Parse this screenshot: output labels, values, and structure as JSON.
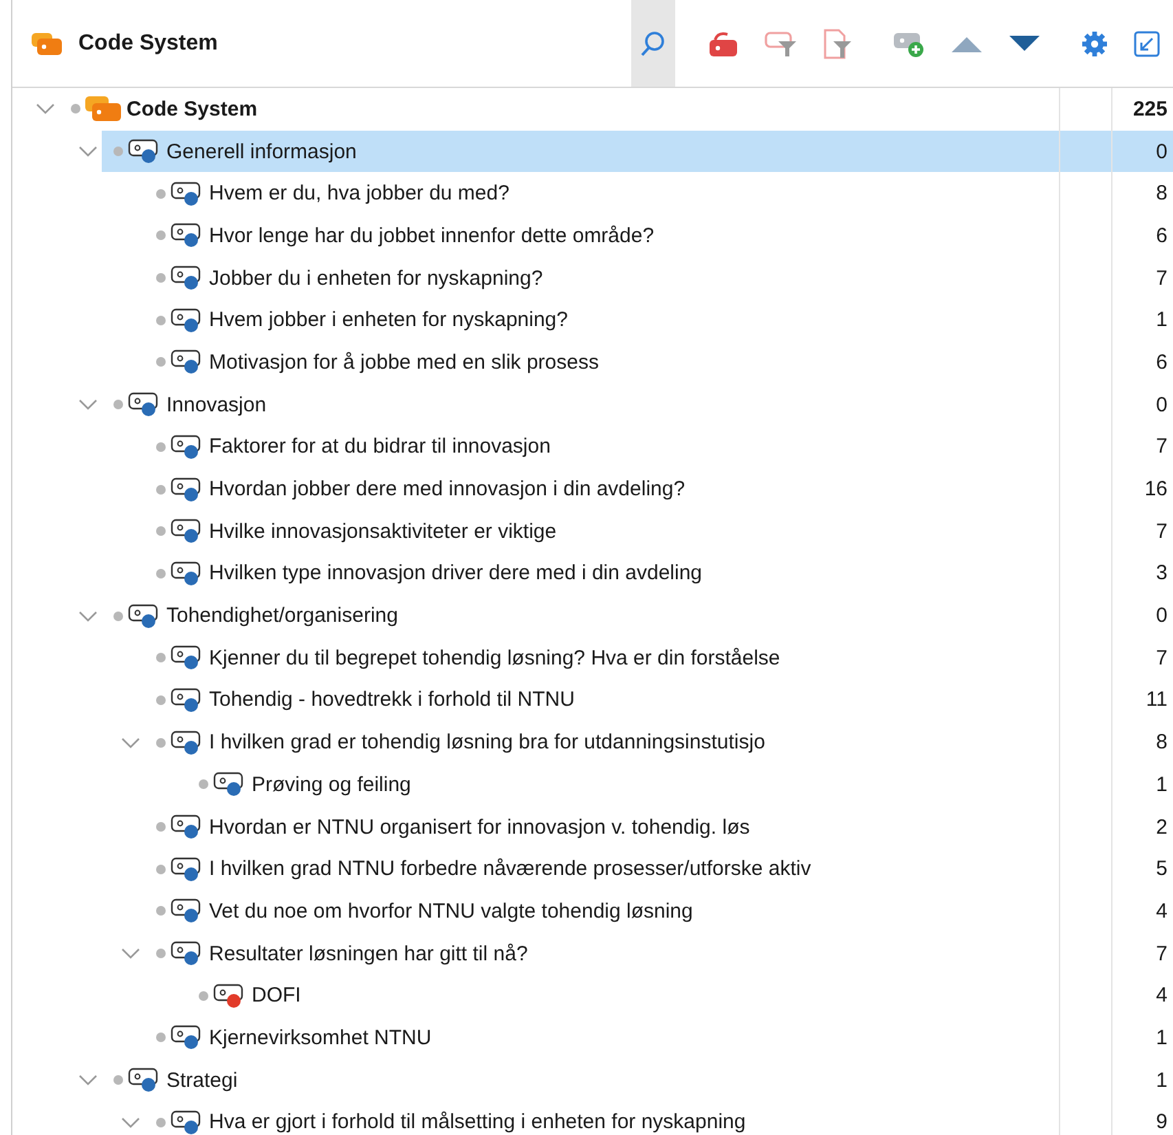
{
  "header": {
    "title": "Code System"
  },
  "tree": {
    "label": "Code System",
    "count": "225",
    "expanded": true,
    "selected": false,
    "children": [
      {
        "label": "Generell informasjon",
        "count": "0",
        "color": "#2a6cb5",
        "expanded": true,
        "selected": true,
        "children": [
          {
            "label": "Hvem er du, hva jobber du med?",
            "count": "8",
            "color": "#2a6cb5",
            "selected": false
          },
          {
            "label": "Hvor lenge har du jobbet innenfor dette område?",
            "count": "6",
            "color": "#2a6cb5",
            "selected": false
          },
          {
            "label": "Jobber du i enheten for nyskapning?",
            "count": "7",
            "color": "#2a6cb5",
            "selected": false
          },
          {
            "label": "Hvem jobber i enheten for nyskapning?",
            "count": "1",
            "color": "#2a6cb5",
            "selected": false
          },
          {
            "label": "Motivasjon for å jobbe med en slik prosess",
            "count": "6",
            "color": "#2a6cb5",
            "selected": false
          }
        ]
      },
      {
        "label": "Innovasjon",
        "count": "0",
        "color": "#2a6cb5",
        "expanded": true,
        "selected": false,
        "children": [
          {
            "label": "Faktorer for at du bidrar til innovasjon",
            "count": "7",
            "color": "#2a6cb5",
            "selected": false
          },
          {
            "label": "Hvordan jobber dere med innovasjon i din avdeling?",
            "count": "16",
            "color": "#2a6cb5",
            "selected": false
          },
          {
            "label": "Hvilke innovasjonsaktiviteter er viktige",
            "count": "7",
            "color": "#2a6cb5",
            "selected": false
          },
          {
            "label": "Hvilken type innovasjon driver dere med i din avdeling",
            "count": "3",
            "color": "#2a6cb5",
            "selected": false
          }
        ]
      },
      {
        "label": "Tohendighet/organisering",
        "count": "0",
        "color": "#2a6cb5",
        "expanded": true,
        "selected": false,
        "children": [
          {
            "label": "Kjenner du til begrepet tohendig løsning? Hva er din forståelse",
            "count": "7",
            "color": "#2a6cb5",
            "selected": false
          },
          {
            "label": "Tohendig - hovedtrekk i forhold til NTNU",
            "count": "11",
            "color": "#2a6cb5",
            "selected": false
          },
          {
            "label": "I hvilken grad er tohendig løsning bra for utdanningsinstutisjo",
            "count": "8",
            "color": "#2a6cb5",
            "expanded": true,
            "selected": false,
            "children": [
              {
                "label": "Prøving og feiling",
                "count": "1",
                "color": "#2a6cb5",
                "selected": false
              }
            ]
          },
          {
            "label": "Hvordan er NTNU organisert for innovasjon v. tohendig. løs",
            "count": "2",
            "color": "#2a6cb5",
            "selected": false
          },
          {
            "label": "I hvilken grad NTNU forbedre nåværende prosesser/utforske aktiv",
            "count": "5",
            "color": "#2a6cb5",
            "selected": false
          },
          {
            "label": "Vet du noe om hvorfor NTNU valgte tohendig løsning",
            "count": "4",
            "color": "#2a6cb5",
            "selected": false
          },
          {
            "label": "Resultater løsningen har gitt til nå?",
            "count": "7",
            "color": "#2a6cb5",
            "expanded": true,
            "selected": false,
            "children": [
              {
                "label": "DOFI",
                "count": "4",
                "color": "#e23b2a",
                "selected": false
              }
            ]
          },
          {
            "label": "Kjernevirksomhet NTNU",
            "count": "1",
            "color": "#2a6cb5",
            "selected": false
          }
        ]
      },
      {
        "label": "Strategi",
        "count": "1",
        "color": "#2a6cb5",
        "expanded": true,
        "selected": false,
        "children": [
          {
            "label": "Hva er gjort i forhold til målsetting i enheten for nyskapning",
            "count": "9",
            "color": "#2a6cb5",
            "expanded": true,
            "selected": false
          }
        ]
      }
    ]
  }
}
